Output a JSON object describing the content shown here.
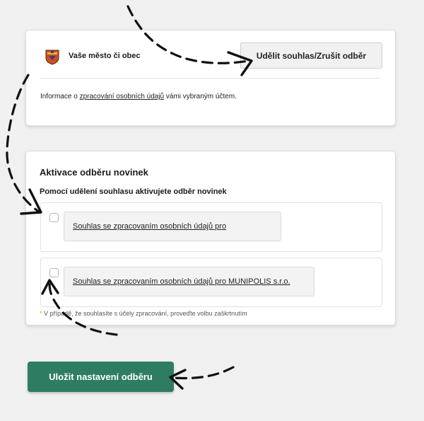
{
  "municipality": {
    "label": "Vaše město či obec",
    "consent_button": "Udělit souhlas/Zrušit odběr",
    "info_prefix": "Informace o ",
    "info_link": "zpracování osobních údajů",
    "info_suffix": " vámi vybraným účtem."
  },
  "subscription": {
    "title": "Aktivace odběru novinek",
    "subtitle": "Pomocí udělení souhlasu aktivujete odběr novinek",
    "options": [
      {
        "label": "Souhlas se zpracovaním osobních údajů pro",
        "checked": false
      },
      {
        "label": "Souhlas se zpracovaním osobních údajů pro MUNIPOLIS s.r.o.",
        "checked": false
      }
    ],
    "footnote_star": "*",
    "footnote_text": " V případě, že souhlasíte s účely zpracování, proveďte volbu zaškrtnutím"
  },
  "save_button": "Uložit nastavení odběru",
  "colors": {
    "primary_button": "#2e7d62",
    "background": "#f0f0f0",
    "footnote_star": "#e0a400"
  },
  "icons": {
    "crest": "municipality-crest-icon"
  }
}
